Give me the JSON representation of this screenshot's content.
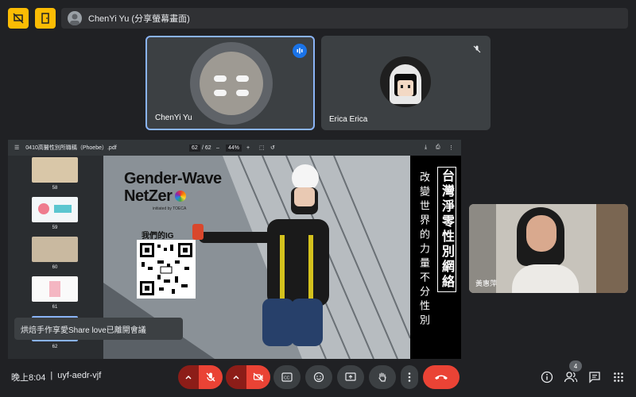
{
  "top": {
    "presenter_label": "ChenYi Yu (分享螢幕畫面)"
  },
  "tiles": [
    {
      "name": "ChenYi Yu"
    },
    {
      "name": "Erica Erica"
    }
  ],
  "pdf": {
    "filename": "0410高醫性別所職稱（Phoebe）.pdf",
    "page_current": "62",
    "page_total": "/ 62",
    "zoom": "44%",
    "thumbnails": [
      "58",
      "59",
      "60",
      "61",
      "62"
    ],
    "slide": {
      "brand_line1": "Gender-Wave",
      "brand_line2": "NetZer",
      "brand_tag": "initiated by TOECA",
      "ig_label": "我們的IG",
      "vertical_title": "台灣淨零性別網絡",
      "vertical_sub": "改變世界的力量不分性別"
    }
  },
  "side_video": {
    "name_label": "黃惠萍"
  },
  "toast": {
    "text": "烘焙手作享愛Share love已離開會議"
  },
  "bottom": {
    "time": "晚上8:04",
    "separator": "|",
    "meeting_code": "uyf-aedr-vjf",
    "participants_count": "4"
  },
  "colors": {
    "accent_yellow": "#fbbc04",
    "speaking_blue": "#8ab4f8",
    "end_call_red": "#ea4335",
    "muted_red": "#8c1d18"
  }
}
